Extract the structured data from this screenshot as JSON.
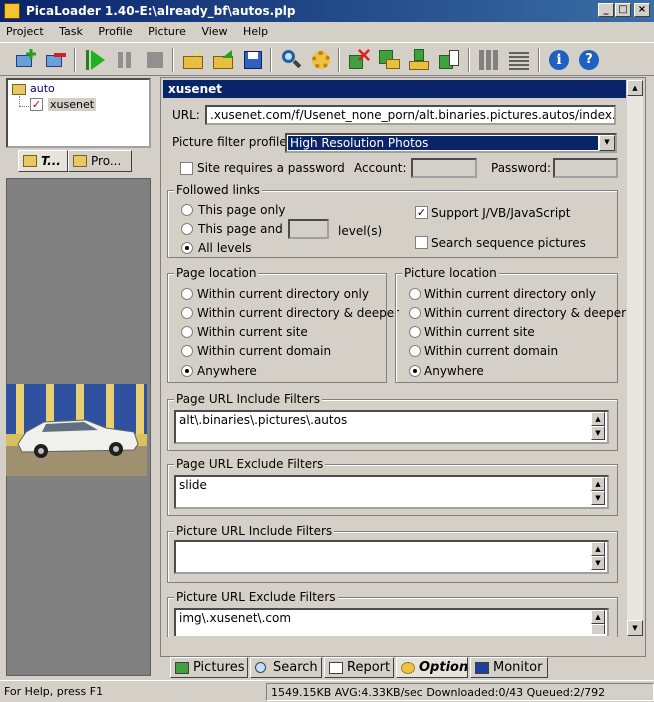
{
  "window": {
    "title": "PicaLoader 1.40-E:\\already_bf\\autos.plp"
  },
  "menu": [
    "Project",
    "Task",
    "Profile",
    "Picture",
    "View",
    "Help"
  ],
  "tree": {
    "root": "auto",
    "child": "xusenet"
  },
  "left_tabs": [
    "T...",
    "Pro..."
  ],
  "panel": {
    "header": "xusenet",
    "url_label": "URL:",
    "url_value": ".xusenet.com/f/Usenet_none_porn/alt.binaries.pictures.autos/index.html",
    "filter_profile_label": "Picture filter profile:",
    "filter_profile_value": "High Resolution Photos",
    "password_required_label": "Site requires a password",
    "account_label": "Account:",
    "password_label": "Password:"
  },
  "followed_links": {
    "title": "Followed links",
    "this_page_only": "This page only",
    "this_page_and": "This page and",
    "levels": "level(s)",
    "all_levels": "All levels",
    "support_js": "Support J/VB/JavaScript",
    "search_sequence": "Search sequence pictures"
  },
  "page_location": {
    "title": "Page location",
    "options": [
      "Within current directory only",
      "Within current directory & deeper",
      "Within current site",
      "Within current domain",
      "Anywhere"
    ]
  },
  "picture_location": {
    "title": "Picture location",
    "options": [
      "Within current directory only",
      "Within current directory & deeper",
      "Within current site",
      "Within current domain",
      "Anywhere"
    ]
  },
  "filters": {
    "page_include": {
      "title": "Page URL Include Filters",
      "value": "alt\\.binaries\\.pictures\\.autos"
    },
    "page_exclude": {
      "title": "Page URL Exclude Filters",
      "value": "slide"
    },
    "picture_include": {
      "title": "Picture URL Include Filters",
      "value": ""
    },
    "picture_exclude": {
      "title": "Picture URL Exclude Filters",
      "value": "img\\.xusenet\\.com"
    }
  },
  "bottom_tabs": [
    "Pictures",
    "Search",
    "Report",
    "Option",
    "Monitor"
  ],
  "status": {
    "help": "For Help, press F1",
    "stats": "1549.15KB AVG:4.33KB/sec Downloaded:0/43 Queued:2/792"
  }
}
